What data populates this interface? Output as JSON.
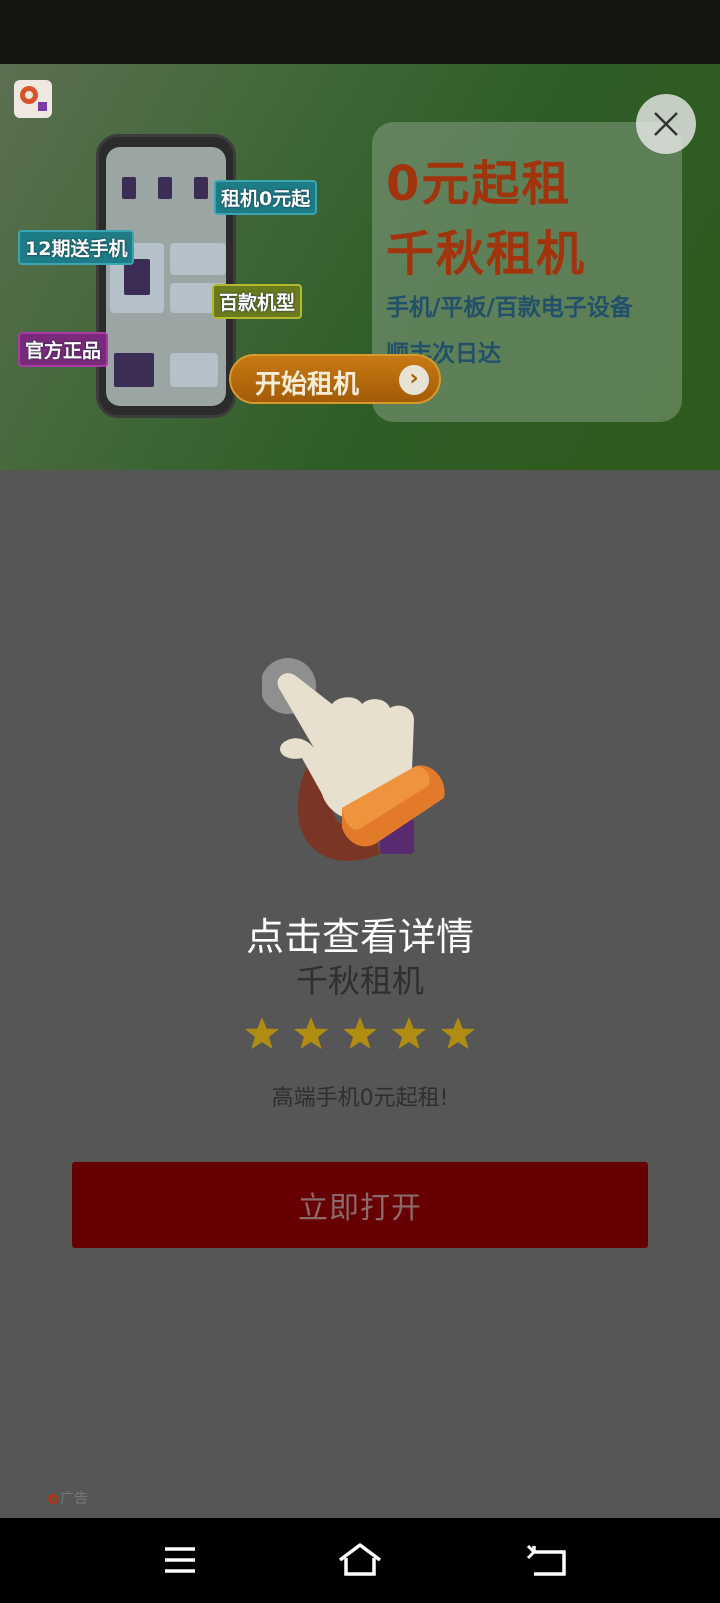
{
  "banner": {
    "tag_rent": "租机0元起",
    "tag_gift": "12期送手机",
    "tag_models": "百款机型",
    "tag_official": "官方正品",
    "start_button": "开始租机",
    "headline_line1": "0元起租",
    "headline_line2": "千秋租机",
    "sub_line1": "手机/平板/百款电子设备",
    "sub_line2": "顺丰次日达"
  },
  "popup": {
    "title": "点击查看详情",
    "app_name": "千秋租机",
    "rating": 5,
    "rating_max": 5,
    "slogan": "高端手机0元起租!",
    "open_button": "立即打开"
  },
  "ad_label": "广告",
  "colors": {
    "overlay": "#565656",
    "primary_button": "#660002",
    "star": "#b08d12",
    "brand_orange": "#d8542a"
  },
  "icons": {
    "close": "close-icon",
    "hand": "pointing-hand-icon",
    "menu": "menu-icon",
    "home": "home-icon",
    "back": "back-icon"
  }
}
